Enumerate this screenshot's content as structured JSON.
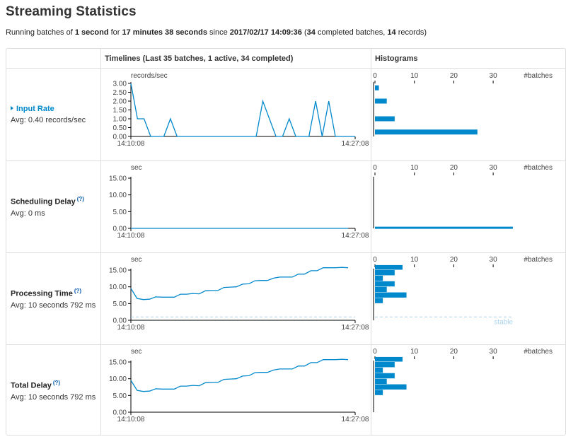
{
  "page_title": "Streaming Statistics",
  "subtitle": {
    "p1": "Running batches of ",
    "batch_interval": "1 second",
    "p2": " for ",
    "uptime": "17 minutes 38 seconds",
    "p3": " since ",
    "start_time": "2017/02/17 14:09:36",
    "p4": " (",
    "completed_batches": "34",
    "p5": " completed batches, ",
    "records": "14",
    "p6": " records)"
  },
  "table": {
    "timelines_header": "Timelines (Last 35 batches, 1 active, 34 completed)",
    "histograms_header": "Histograms"
  },
  "time_start": "14:10:08",
  "time_end": "14:27:08",
  "hist_unit": "#batches",
  "stable_label": "stable",
  "colors": {
    "line": "#0088cc",
    "bar": "#0088cc",
    "stable": "#aad4ec",
    "link": "#0088cc"
  },
  "metrics": [
    {
      "name": "Input Rate",
      "avg": "Avg: 0.40 records/sec",
      "help": "",
      "expandable": true,
      "caret_icon": "caret-right-icon"
    },
    {
      "name": "Scheduling Delay",
      "avg": "Avg: 0 ms",
      "help": "(?)",
      "expandable": false
    },
    {
      "name": "Processing Time",
      "avg": "Avg: 10 seconds 792 ms",
      "help": "(?)",
      "expandable": false
    },
    {
      "name": "Total Delay",
      "avg": "Avg: 10 seconds 792 ms",
      "help": "(?)",
      "expandable": false
    }
  ],
  "chart_data": [
    {
      "type": "line",
      "title": "Input Rate timeline",
      "ylabel": "records/sec",
      "ylim": [
        0,
        3
      ],
      "yticks": [
        "3.00",
        "2.50",
        "2.00",
        "1.50",
        "1.00",
        "0.50",
        "0.00"
      ],
      "x_start": "14:10:08",
      "x_end": "14:27:08",
      "values": [
        3,
        1,
        1,
        0,
        0,
        0,
        1,
        0,
        0,
        0,
        0,
        0,
        0,
        0,
        0,
        0,
        0,
        0,
        0,
        0,
        2,
        1,
        0,
        0,
        1,
        0,
        0,
        0,
        2,
        0,
        2,
        0,
        0,
        0,
        0
      ]
    },
    {
      "type": "bar",
      "title": "Input Rate histogram",
      "xlabel": "#batches",
      "xlim": [
        0,
        35
      ],
      "xticks": [
        "0",
        "10",
        "20",
        "30"
      ],
      "bins": [
        {
          "low": 0,
          "high": 0.5,
          "count": 26
        },
        {
          "low": 0.5,
          "high": 1.5,
          "count": 5
        },
        {
          "low": 1.5,
          "high": 2.5,
          "count": 3
        },
        {
          "low": 2.5,
          "high": 3,
          "count": 1
        }
      ]
    },
    {
      "type": "line",
      "title": "Scheduling Delay timeline",
      "ylabel": "sec",
      "ylim": [
        0,
        15
      ],
      "yticks": [
        "15.00",
        "10.00",
        "5.00",
        "0.00"
      ],
      "x_start": "14:10:08",
      "x_end": "14:27:08",
      "values": [
        0,
        0,
        0,
        0,
        0,
        0,
        0,
        0,
        0,
        0,
        0,
        0,
        0,
        0,
        0,
        0,
        0,
        0,
        0,
        0,
        0,
        0,
        0,
        0,
        0,
        0,
        0,
        0,
        0,
        0,
        0,
        0,
        0,
        0,
        0
      ]
    },
    {
      "type": "bar",
      "title": "Scheduling Delay histogram",
      "xlabel": "#batches",
      "xlim": [
        0,
        35
      ],
      "xticks": [
        "0",
        "10",
        "20",
        "30"
      ],
      "bins": [
        {
          "low": 0,
          "high": 0.5,
          "count": 35
        }
      ]
    },
    {
      "type": "line",
      "title": "Processing Time timeline",
      "ylabel": "sec",
      "ylim": [
        0,
        15
      ],
      "yticks": [
        "15.00",
        "10.00",
        "5.00",
        "0.00"
      ],
      "x_start": "14:10:08",
      "x_end": "14:27:08",
      "values": [
        9.5,
        6.5,
        6.2,
        6.3,
        7,
        6.9,
        6.9,
        6.9,
        7.8,
        7.8,
        8,
        7.9,
        8.8,
        8.9,
        8.9,
        9.8,
        9.9,
        10,
        10.8,
        10.9,
        11.8,
        11.9,
        11.9,
        12.6,
        12.9,
        12.9,
        12.9,
        13.8,
        13.8,
        14.8,
        14.8,
        15.7,
        15.7,
        15.7,
        15.8,
        15.7
      ],
      "stable_threshold": 1
    },
    {
      "type": "bar",
      "title": "Processing Time histogram",
      "xlabel": "#batches",
      "xlim": [
        0,
        35
      ],
      "xticks": [
        "0",
        "10",
        "20",
        "30"
      ],
      "bins": [
        {
          "low": 5,
          "high": 6.67,
          "count": 2
        },
        {
          "low": 6.67,
          "high": 8.33,
          "count": 8
        },
        {
          "low": 8.33,
          "high": 10,
          "count": 3
        },
        {
          "low": 10,
          "high": 11.67,
          "count": 5
        },
        {
          "low": 11.67,
          "high": 13.33,
          "count": 2
        },
        {
          "low": 13.33,
          "high": 15,
          "count": 5
        },
        {
          "low": 15,
          "high": 16.67,
          "count": 7
        }
      ]
    },
    {
      "type": "line",
      "title": "Total Delay timeline",
      "ylabel": "sec",
      "ylim": [
        0,
        15
      ],
      "yticks": [
        "15.00",
        "10.00",
        "5.00",
        "0.00"
      ],
      "x_start": "14:10:08",
      "x_end": "14:27:08",
      "values": [
        9.5,
        6.5,
        6.2,
        6.3,
        7,
        6.9,
        6.9,
        6.9,
        7.8,
        7.8,
        8,
        7.9,
        8.8,
        8.9,
        8.9,
        9.8,
        9.9,
        10,
        10.8,
        10.9,
        11.8,
        11.9,
        11.9,
        12.6,
        12.9,
        12.9,
        12.9,
        13.8,
        13.8,
        14.8,
        14.8,
        15.7,
        15.7,
        15.7,
        15.8,
        15.7
      ]
    },
    {
      "type": "bar",
      "title": "Total Delay histogram",
      "xlabel": "#batches",
      "xlim": [
        0,
        35
      ],
      "xticks": [
        "0",
        "10",
        "20",
        "30"
      ],
      "bins": [
        {
          "low": 5,
          "high": 6.67,
          "count": 2
        },
        {
          "low": 6.67,
          "high": 8.33,
          "count": 8
        },
        {
          "low": 8.33,
          "high": 10,
          "count": 3
        },
        {
          "low": 10,
          "high": 11.67,
          "count": 5
        },
        {
          "low": 11.67,
          "high": 13.33,
          "count": 2
        },
        {
          "low": 13.33,
          "high": 15,
          "count": 5
        },
        {
          "low": 15,
          "high": 16.67,
          "count": 7
        }
      ]
    }
  ]
}
